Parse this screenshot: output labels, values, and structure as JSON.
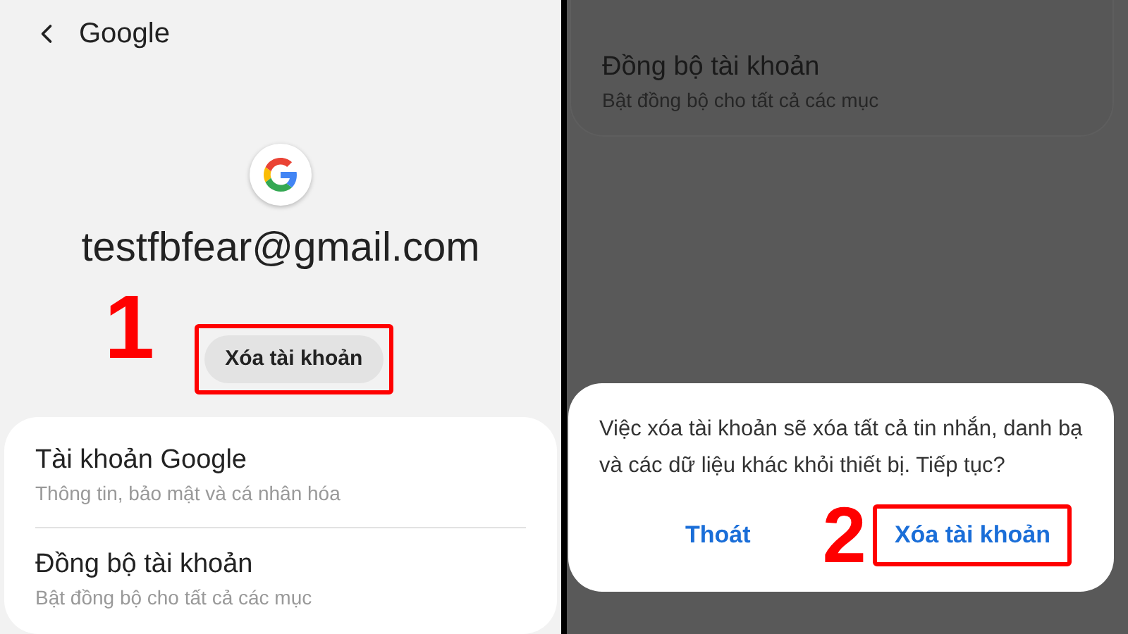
{
  "left_screen": {
    "header": {
      "title": "Google"
    },
    "account": {
      "email": "testfbfear@gmail.com"
    },
    "step_label": "1",
    "remove_button": {
      "label": "Xóa tài khoản",
      "highlighted": true
    },
    "settings_list": [
      {
        "title": "Tài khoản Google",
        "subtitle": "Thông tin, bảo mật và cá nhân hóa"
      },
      {
        "title": "Đồng bộ tài khoản",
        "subtitle": "Bật đồng bộ cho tất cả các mục"
      }
    ]
  },
  "right_screen": {
    "background_item": {
      "title": "Đồng bộ tài khoản",
      "subtitle": "Bật đồng bộ cho tất cả các mục"
    },
    "dialog": {
      "message": "Việc xóa tài khoản sẽ xóa tất cả tin nhắn, danh bạ và các dữ liệu khác khỏi thiết bị. Tiếp tục?",
      "step_label": "2",
      "buttons": [
        {
          "label": "Thoát",
          "highlighted": false
        },
        {
          "label": "Xóa tài khoản",
          "highlighted": true
        }
      ]
    }
  }
}
